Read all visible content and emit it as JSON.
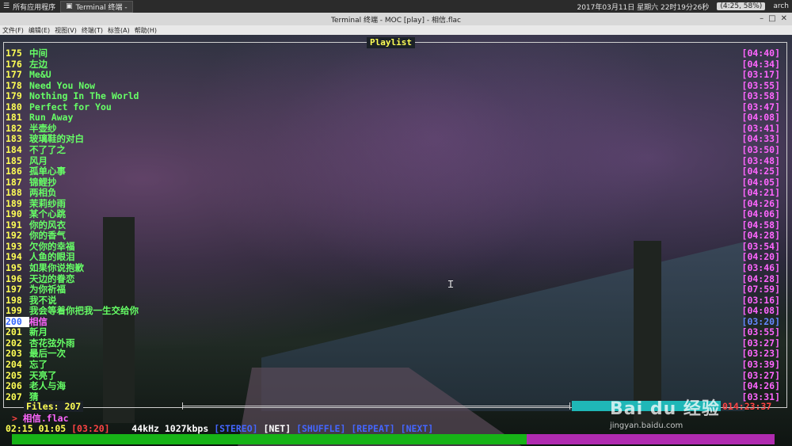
{
  "taskbar": {
    "apps_menu": "所有应用程序",
    "task_label": "Terminal 终端 -",
    "datetime": "2017年03月11日 星期六 22时19分26秒",
    "battery": "(4:25, 58%)",
    "user": "arch"
  },
  "window": {
    "title": "Terminal 终端 - MOC [play] - 相信.flac"
  },
  "menubar": [
    "文件(F)",
    "编辑(E)",
    "视图(V)",
    "终端(T)",
    "标签(A)",
    "帮助(H)"
  ],
  "playlist": {
    "title": "Playlist",
    "items": [
      {
        "num": "175",
        "title": "中间",
        "duration": "[04:40]"
      },
      {
        "num": "176",
        "title": "左边",
        "duration": "[04:34]"
      },
      {
        "num": "177",
        "title": "Me&U",
        "duration": "[03:17]"
      },
      {
        "num": "178",
        "title": "Need You Now",
        "duration": "[03:55]"
      },
      {
        "num": "179",
        "title": "Nothing In The World",
        "duration": "[03:58]"
      },
      {
        "num": "180",
        "title": "Perfect for You",
        "duration": "[03:47]"
      },
      {
        "num": "181",
        "title": "Run Away",
        "duration": "[04:08]"
      },
      {
        "num": "182",
        "title": "半壶纱",
        "duration": "[03:41]"
      },
      {
        "num": "183",
        "title": "玻璃鞋的对白",
        "duration": "[04:33]"
      },
      {
        "num": "184",
        "title": "不了了之",
        "duration": "[03:50]"
      },
      {
        "num": "185",
        "title": "风月",
        "duration": "[03:48]"
      },
      {
        "num": "186",
        "title": "孤单心事",
        "duration": "[04:25]"
      },
      {
        "num": "187",
        "title": "锦鲤抄",
        "duration": "[04:05]"
      },
      {
        "num": "188",
        "title": "两相负",
        "duration": "[04:21]"
      },
      {
        "num": "189",
        "title": "茉莉纱雨",
        "duration": "[04:26]"
      },
      {
        "num": "190",
        "title": "某个心跳",
        "duration": "[04:06]"
      },
      {
        "num": "191",
        "title": "你的风衣",
        "duration": "[04:58]"
      },
      {
        "num": "192",
        "title": "你的香气",
        "duration": "[04:28]"
      },
      {
        "num": "193",
        "title": "欠你的幸福",
        "duration": "[03:54]"
      },
      {
        "num": "194",
        "title": "人鱼的眼泪",
        "duration": "[04:20]"
      },
      {
        "num": "195",
        "title": "如果你说抱歉",
        "duration": "[03:46]"
      },
      {
        "num": "196",
        "title": "天边的眷恋",
        "duration": "[04:28]"
      },
      {
        "num": "197",
        "title": "为你祈福",
        "duration": "[07:59]"
      },
      {
        "num": "198",
        "title": "我不说",
        "duration": "[03:16]"
      },
      {
        "num": "199",
        "title": "我会等着你把我一生交给你",
        "duration": "[04:08]"
      },
      {
        "num": "200",
        "title": "相信",
        "duration": "[03:20]",
        "current": true
      },
      {
        "num": "201",
        "title": "新月",
        "duration": "[03:55]"
      },
      {
        "num": "202",
        "title": "杏花弦外雨",
        "duration": "[03:27]"
      },
      {
        "num": "203",
        "title": "最后一次",
        "duration": "[03:23]"
      },
      {
        "num": "204",
        "title": "忘了",
        "duration": "[03:39]"
      },
      {
        "num": "205",
        "title": "天亮了",
        "duration": "[03:27]"
      },
      {
        "num": "206",
        "title": "老人与海",
        "duration": "[04:26]"
      },
      {
        "num": "207",
        "title": "猜",
        "duration": "[03:31]"
      }
    ],
    "files_count": "Files: 207",
    "total_time": "014:23:37"
  },
  "player": {
    "now_playing_marker": ">",
    "now_playing": "相信.flac",
    "time_left": "02:15",
    "time_elapsed": "01:05",
    "time_total": "[03:20]",
    "frequency": "44kHz",
    "bitrate": "1027kbps",
    "stereo": "[STEREO]",
    "net": "[NET]",
    "shuffle": "[SHUFFLE]",
    "repeat": "[REPEAT]",
    "next": "[NEXT]",
    "progress_fraction": 0.675
  },
  "watermark": {
    "logo": "Bai du 经验",
    "url": "jingyan.baidu.com"
  }
}
